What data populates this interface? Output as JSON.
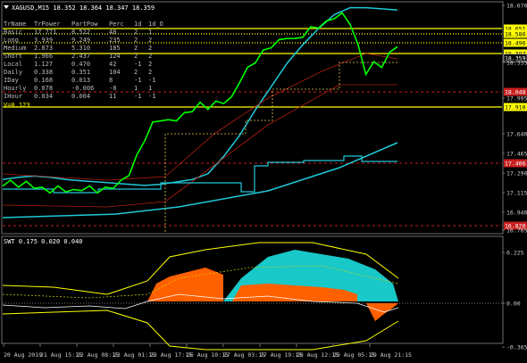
{
  "window": {
    "symbol_title": "XAGUSD,M15  18.352 18.364 18.347 18.359",
    "indicator_title": "SWT 0.175 0.020 0.040"
  },
  "colors": {
    "background": "#000000",
    "price_line": "#00ff00",
    "upper_band": "#20c8d8",
    "levels": "#ffff00",
    "red_level": "#c81e1e",
    "indicator_fill": "#19c8c8",
    "indicator_orange": "#ff6000"
  },
  "table": {
    "headers": [
      "TrName",
      "TrPower",
      "PartPow",
      "Perc",
      "1d",
      "1d_O"
    ],
    "rows": [
      {
        "name": "Basic",
        "power": "17.771",
        "part": "8.522",
        "perc": "48",
        "d": "2",
        "o": "1"
      },
      {
        "name": "Long",
        "power": "3.939",
        "part": "9.249",
        "perc": "235",
        "d": "2",
        "o": "2"
      },
      {
        "name": "Medium",
        "power": "2.873",
        "part": "5.310",
        "perc": "185",
        "d": "2",
        "o": "2"
      },
      {
        "name": "Short",
        "power": "1.966",
        "part": "2.437",
        "perc": "124",
        "d": "2",
        "o": "2"
      },
      {
        "name": "Local",
        "power": "1.127",
        "part": "0.470",
        "perc": "42",
        "d": "-1",
        "o": "2"
      },
      {
        "name": "Daily",
        "power": "0.338",
        "part": "0.351",
        "perc": "104",
        "d": "2",
        "o": "2"
      },
      {
        "name": "IDay",
        "power": "0.168",
        "part": "0.013",
        "perc": "8",
        "d": "-1",
        "o": "-1"
      },
      {
        "name": "Hourly",
        "power": "0.078",
        "part": "-0.006",
        "perc": "-8",
        "d": "1",
        "o": "1"
      },
      {
        "name": "IHour",
        "power": "0.034",
        "part": "0.004",
        "perc": "11",
        "d": "-1",
        "o": "-1"
      }
    ],
    "v_line": "V=0.123"
  },
  "price_axis": {
    "ticks": [
      "18.670",
      "18.335",
      "17.995",
      "17.640",
      "17.465",
      "17.290",
      "17.115",
      "16.940",
      "16.765"
    ],
    "highlight_labels": [
      {
        "text": "18.651",
        "kind": "level"
      },
      {
        "text": "18.586",
        "kind": "level"
      },
      {
        "text": "18.496",
        "kind": "level"
      },
      {
        "text": "18.397",
        "kind": "level"
      },
      {
        "text": "18.359",
        "kind": "price"
      },
      {
        "text": "18.048",
        "kind": "red"
      },
      {
        "text": "17.910",
        "kind": "level"
      },
      {
        "text": "17.406",
        "kind": "red"
      },
      {
        "text": "16.820",
        "kind": "red"
      }
    ]
  },
  "indicator_axis": {
    "ticks": [
      "0.225",
      "0.00",
      "-0.365"
    ]
  },
  "time_axis": {
    "labels": [
      "20 Aug 2019",
      "21 Aug 15:15",
      "22 Aug 08:15",
      "23 Aug 01:15",
      "23 Aug 17:15",
      "26 Aug 10:15",
      "27 Aug 03:15",
      "27 Aug 19:15",
      "28 Aug 12:15",
      "29 Aug 05:15",
      "29 Aug 21:15"
    ]
  },
  "chart_data": {
    "type": "line",
    "title": "XAGUSD,M15  18.352 18.364 18.347 18.359",
    "series": [
      {
        "values": [
          17.16,
          17.18,
          17.15,
          17.17,
          17.14,
          17.12,
          17.1,
          17.13,
          17.11,
          17.1,
          17.12,
          17.13,
          17.1,
          17.12,
          17.14,
          17.18,
          17.25,
          17.4,
          17.55,
          17.68,
          17.72,
          17.7,
          17.72,
          17.76,
          17.8,
          17.85,
          17.82,
          17.86,
          17.87,
          17.9,
          18.05,
          18.15,
          18.22,
          18.3,
          18.35,
          18.39,
          18.43,
          18.4,
          18.44,
          18.5,
          18.52,
          18.55,
          18.6,
          18.62,
          18.55,
          18.35,
          18.12,
          18.2,
          18.18,
          18.28,
          18.36
        ]
      },
      {
        "values": [
          17.2,
          17.22,
          17.23,
          17.22,
          17.2,
          17.19,
          17.18,
          17.17,
          17.16,
          17.15,
          17.16,
          17.18,
          17.2,
          17.25,
          17.4,
          17.58,
          17.8,
          18.0,
          18.2,
          18.36,
          18.5,
          18.62,
          18.68,
          18.68,
          18.67,
          18.66
        ]
      },
      {
        "values": [
          17.4,
          17.4,
          17.4,
          17.4,
          17.4,
          17.4,
          17.4,
          17.4,
          17.4
        ]
      }
    ],
    "ylim": [
      16.765,
      18.7
    ]
  }
}
